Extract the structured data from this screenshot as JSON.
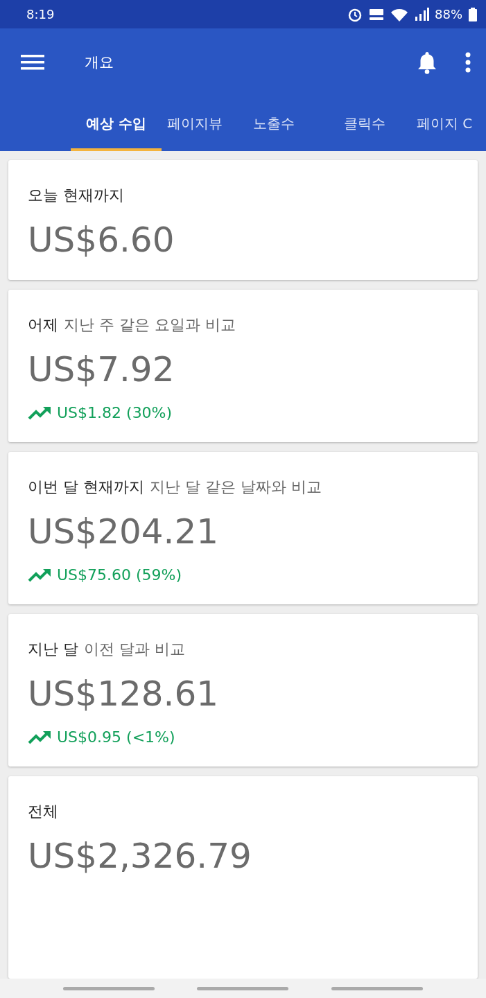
{
  "status_bar": {
    "time": "8:19",
    "battery": "88%"
  },
  "app_bar": {
    "title": "개요"
  },
  "tabs": [
    {
      "label": "예상 수입",
      "selected": true
    },
    {
      "label": "페이지뷰",
      "selected": false
    },
    {
      "label": "노출수",
      "selected": false
    },
    {
      "label": "클릭수",
      "selected": false
    },
    {
      "label": "페이지 C",
      "selected": false
    }
  ],
  "cards": [
    {
      "title": "오늘 현재까지",
      "value": "US$6.60"
    },
    {
      "title": "어제",
      "comparison": "지난 주 같은 요일과 비교",
      "value": "US$7.92",
      "change": "US$1.82 (30%)"
    },
    {
      "title": "이번 달 현재까지",
      "comparison": "지난 달 같은 날짜와 비교",
      "value": "US$204.21",
      "change": "US$75.60 (59%)"
    },
    {
      "title": "지난 달",
      "comparison": "이전 달과 비교",
      "value": "US$128.61",
      "change": "US$0.95 (<1%)"
    },
    {
      "title": "전체",
      "value": "US$2,326.79"
    }
  ]
}
